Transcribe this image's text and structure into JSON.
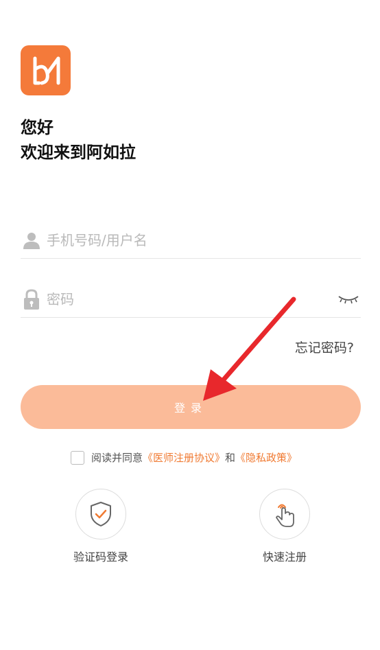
{
  "greeting": {
    "line1": "您好",
    "line2": "欢迎来到阿如拉"
  },
  "username": {
    "placeholder": "手机号码/用户名",
    "value": ""
  },
  "password": {
    "placeholder": "密码",
    "value": ""
  },
  "forgot_label": "忘记密码?",
  "login_label": "登录",
  "agreement": {
    "prefix": "阅读并同意",
    "link1": "《医师注册协议》",
    "and": "和",
    "link2": "《隐私政策》",
    "checked": false
  },
  "quick_actions": [
    {
      "label": "验证码登录",
      "icon": "shield-check-icon"
    },
    {
      "label": "快速注册",
      "icon": "tap-hand-icon"
    }
  ],
  "colors": {
    "brand": "#f47a3a",
    "button": "#fbbb99",
    "link": "#f07a32",
    "annotation_arrow": "#e8282c"
  }
}
